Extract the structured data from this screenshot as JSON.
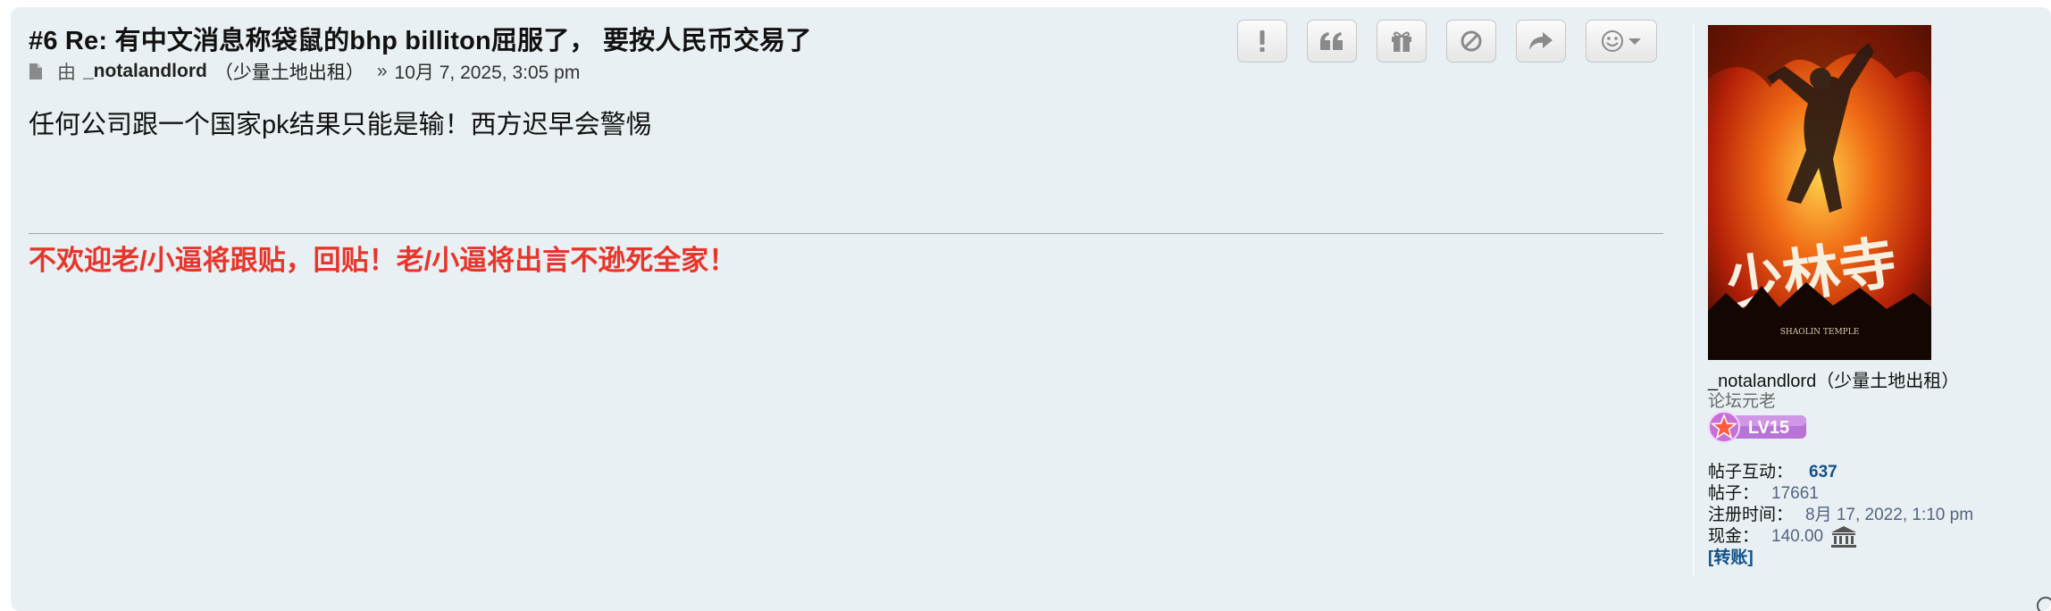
{
  "post": {
    "title": "#6 Re: 有中文消息称袋鼠的bhp billiton屈服了， 要按人民币交易了",
    "meta": {
      "by": "由",
      "author": "_notalandlord",
      "author_alias": "（少量土地出租）",
      "separator": "»",
      "datetime": "10月 7, 2025, 3:05 pm"
    },
    "content": "任何公司跟一个国家pk结果只能是输！西方迟早会警惕",
    "signature": "不欢迎老/小逼将跟贴，回贴！老/小逼将出言不逊死全家！"
  },
  "actions": [
    {
      "name": "report-button",
      "icon": "exclamation-icon"
    },
    {
      "name": "quote-button",
      "icon": "quote-icon"
    },
    {
      "name": "gift-button",
      "icon": "gift-icon"
    },
    {
      "name": "ignore-button",
      "icon": "ban-icon"
    },
    {
      "name": "share-button",
      "icon": "share-arrow-icon"
    },
    {
      "name": "reaction-button",
      "icon": "smiley-icon"
    }
  ],
  "profile": {
    "name": "_notalandlord（少量土地出租）",
    "rank": "论坛元老",
    "level_badge": "LV15",
    "avatar_caption": "SHAOLIN TEMPLE",
    "stats": {
      "interactions_label": "帖子互动：",
      "interactions_value": "637",
      "posts_label": "帖子：",
      "posts_value": "17661",
      "joined_label": "注册时间：",
      "joined_value": "8月 17, 2022, 1:10 pm",
      "cash_label": "现金：",
      "cash_value": "140.00",
      "transfer_link": "[转账]"
    }
  },
  "colors": {
    "post_background": "#e9f0f3",
    "signature_red": "#e8352b",
    "link_blue": "#105289",
    "stat_value_gray_blue": "#536482"
  }
}
